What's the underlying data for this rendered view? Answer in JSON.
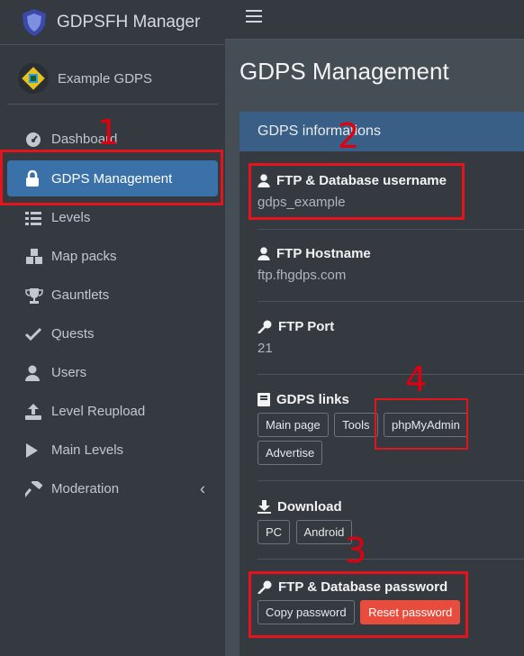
{
  "brand": {
    "title": "GDPSFH Manager"
  },
  "user": {
    "name": "Example GDPS"
  },
  "sidebar": {
    "items": [
      {
        "label": "Dashboard",
        "icon": "dashboard-icon"
      },
      {
        "label": "GDPS Management",
        "icon": "lock-icon"
      },
      {
        "label": "Levels",
        "icon": "list-icon"
      },
      {
        "label": "Map packs",
        "icon": "cubes-icon"
      },
      {
        "label": "Gauntlets",
        "icon": "trophy-icon"
      },
      {
        "label": "Quests",
        "icon": "check-icon"
      },
      {
        "label": "Users",
        "icon": "user-icon"
      },
      {
        "label": "Level Reupload",
        "icon": "upload-icon"
      },
      {
        "label": "Main Levels",
        "icon": "play-icon"
      },
      {
        "label": "Moderation",
        "icon": "hammer-icon"
      }
    ]
  },
  "main": {
    "title": "GDPS Management",
    "card_title": "GDPS informations",
    "username": {
      "label": "FTP & Database username",
      "value": "gdps_example"
    },
    "hostname": {
      "label": "FTP Hostname",
      "value": "ftp.fhgdps.com"
    },
    "port": {
      "label": "FTP Port",
      "value": "21"
    },
    "links": {
      "label": "GDPS links",
      "buttons": [
        "Main page",
        "Tools",
        "phpMyAdmin",
        "Advertise"
      ]
    },
    "download": {
      "label": "Download",
      "buttons": [
        "PC",
        "Android"
      ]
    },
    "password": {
      "label": "FTP & Database password",
      "copy": "Copy password",
      "reset": "Reset password"
    }
  },
  "annotations": [
    "1",
    "2",
    "3",
    "4"
  ],
  "colors": {
    "accent": "#3a71a8",
    "annotation": "#e4131c",
    "danger": "#e74c3c"
  }
}
